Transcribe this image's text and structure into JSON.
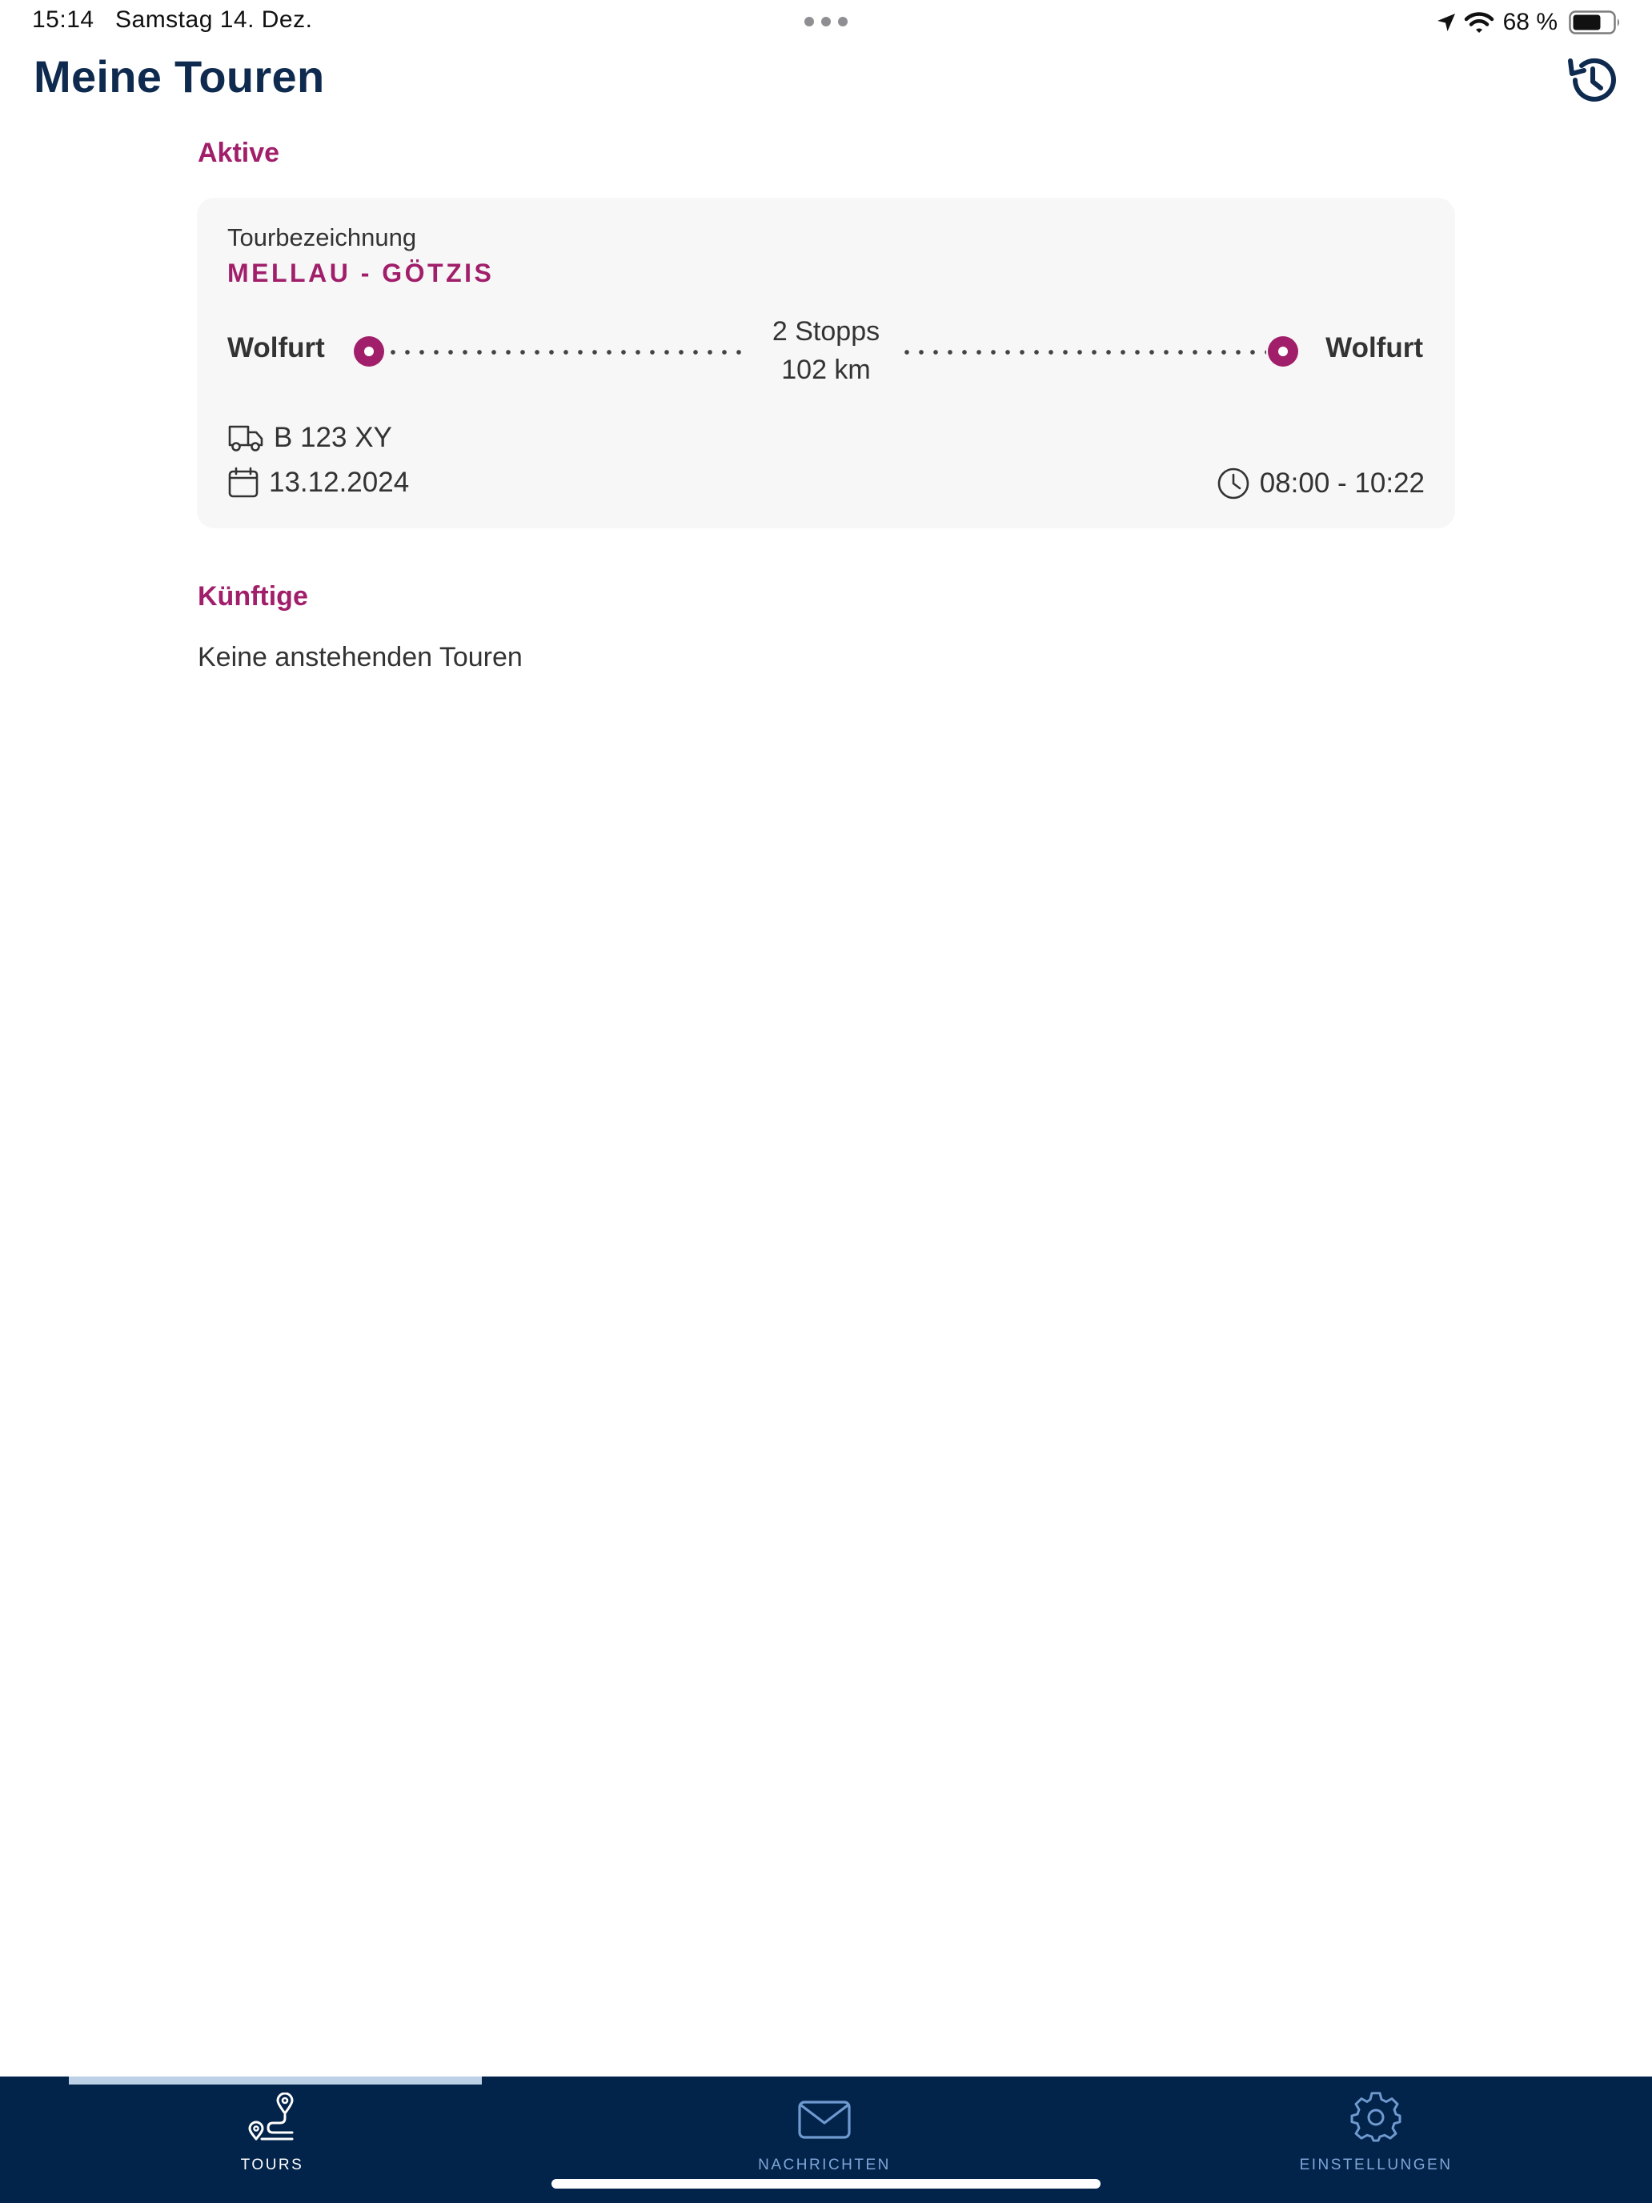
{
  "status_bar": {
    "time": "15:14",
    "date": "Samstag 14. Dez.",
    "battery_percent": "68 %"
  },
  "header": {
    "title": "Meine Touren",
    "history_icon": "history-icon"
  },
  "sections": {
    "active": {
      "heading": "Aktive",
      "tour": {
        "label": "Tourbezeichnung",
        "name": "MELLAU - GÖTZIS",
        "start": "Wolfurt",
        "end": "Wolfurt",
        "stops": "2 Stopps",
        "distance": "102 km",
        "vehicle": "B 123 XY",
        "date": "13.12.2024",
        "time_range": "08:00 - 10:22"
      }
    },
    "future": {
      "heading": "Künftige",
      "empty_text": "Keine anstehenden Touren"
    }
  },
  "tab_bar": {
    "tabs": [
      {
        "label": "TOURS",
        "icon": "route-icon",
        "active": true
      },
      {
        "label": "NACHRICHTEN",
        "icon": "envelope-icon",
        "active": false
      },
      {
        "label": "EINSTELLUNGEN",
        "icon": "gear-icon",
        "active": false
      }
    ]
  },
  "colors": {
    "brand_navy": "#03244a",
    "title_navy": "#0f2a4f",
    "accent_magenta": "#a11f6a",
    "card_background": "#f7f7f7",
    "inactive_tab": "#7ea6d8",
    "active_tab_indicator": "#bcd0e6"
  }
}
